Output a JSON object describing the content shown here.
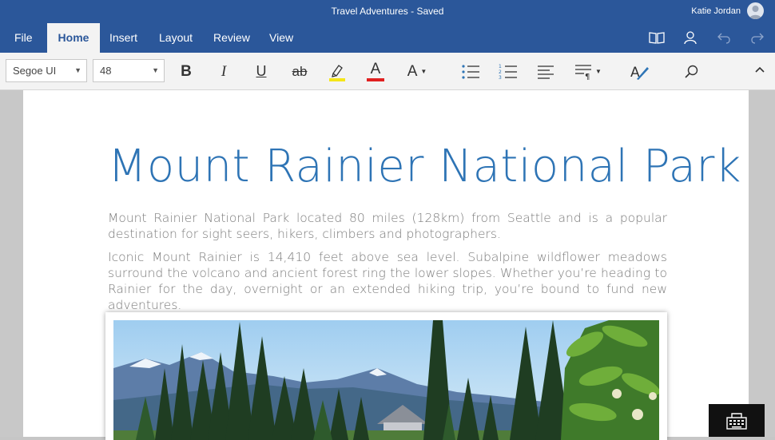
{
  "window": {
    "title": "Travel Adventures - Saved",
    "user_name": "Katie Jordan"
  },
  "tabs": [
    {
      "label": "File"
    },
    {
      "label": "Home"
    },
    {
      "label": "Insert"
    },
    {
      "label": "Layout"
    },
    {
      "label": "Review"
    },
    {
      "label": "View"
    }
  ],
  "active_tab": "Home",
  "ribbon": {
    "font_name": "Segoe UI",
    "font_size": "48",
    "bold_glyph": "B",
    "italic_glyph": "I",
    "underline_glyph": "U",
    "strike_glyph": "ab",
    "font_color_glyph": "A",
    "font_format_glyph": "A"
  },
  "colors": {
    "brand": "#2b579a",
    "highlight": "#f5e619",
    "font_color": "#e02020",
    "heading": "#2e74b5"
  },
  "document": {
    "heading": "Mount Rainier National Park",
    "paragraph1": "Mount Rainier National Park located 80 miles (128km) from Seattle and is a popular destination for sight seers, hikers, climbers and photographers.",
    "paragraph2": "Iconic Mount Rainier is 14,410 feet above sea level. Subalpine wildflower meadows surround the volcano and ancient forest ring the lower slopes. Whether you’re heading to Rainier for the day, overnight or an extended hiking trip, you’re bound to fund new adventures."
  }
}
